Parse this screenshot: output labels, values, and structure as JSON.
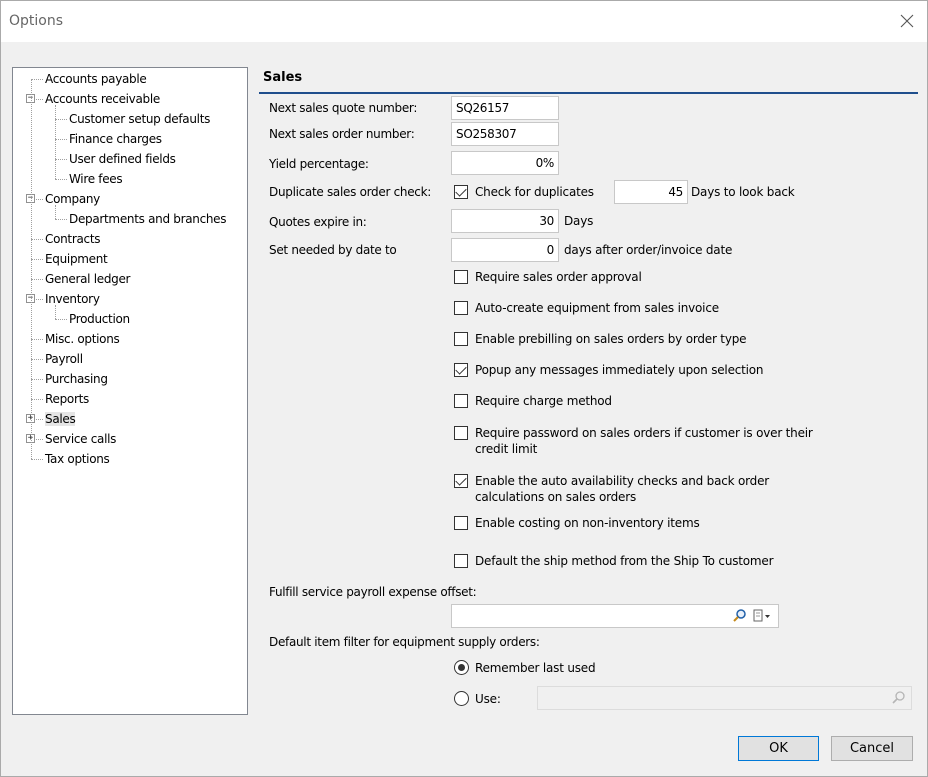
{
  "window": {
    "title": "Options"
  },
  "tree": [
    {
      "label": "Accounts payable",
      "level": 0,
      "expander": ""
    },
    {
      "label": "Accounts receivable",
      "level": 0,
      "expander": "−"
    },
    {
      "label": "Customer setup defaults",
      "level": 1,
      "expander": ""
    },
    {
      "label": "Finance charges",
      "level": 1,
      "expander": ""
    },
    {
      "label": "User defined fields",
      "level": 1,
      "expander": ""
    },
    {
      "label": "Wire fees",
      "level": 1,
      "expander": ""
    },
    {
      "label": "Company",
      "level": 0,
      "expander": "−"
    },
    {
      "label": "Departments and branches",
      "level": 1,
      "expander": ""
    },
    {
      "label": "Contracts",
      "level": 0,
      "expander": ""
    },
    {
      "label": "Equipment",
      "level": 0,
      "expander": ""
    },
    {
      "label": "General ledger",
      "level": 0,
      "expander": ""
    },
    {
      "label": "Inventory",
      "level": 0,
      "expander": "−"
    },
    {
      "label": "Production",
      "level": 1,
      "expander": ""
    },
    {
      "label": "Misc. options",
      "level": 0,
      "expander": ""
    },
    {
      "label": "Payroll",
      "level": 0,
      "expander": ""
    },
    {
      "label": "Purchasing",
      "level": 0,
      "expander": ""
    },
    {
      "label": "Reports",
      "level": 0,
      "expander": ""
    },
    {
      "label": "Sales",
      "level": 0,
      "expander": "+",
      "selected": true
    },
    {
      "label": "Service calls",
      "level": 0,
      "expander": "+"
    },
    {
      "label": "Tax options",
      "level": 0,
      "expander": ""
    }
  ],
  "section": {
    "title": "Sales"
  },
  "fields": {
    "next_quote_label": "Next sales quote number:",
    "next_quote_value": "SQ26157",
    "next_order_label": "Next sales order number:",
    "next_order_value": "SO258307",
    "yield_label": "Yield percentage:",
    "yield_value": "0%",
    "dup_label": "Duplicate sales order check:",
    "dup_check_label": "Check for duplicates",
    "dup_check": true,
    "dup_days_value": "45",
    "dup_days_label": "Days to look back",
    "quotes_label": "Quotes expire in:",
    "quotes_value": "30",
    "quotes_unit": "Days",
    "needed_label": "Set needed by date to",
    "needed_value": "0",
    "needed_unit": "days after order/invoice date"
  },
  "options": [
    {
      "label": "Require sales order approval",
      "checked": false
    },
    {
      "label": "Auto-create equipment from sales invoice",
      "checked": false
    },
    {
      "label": "Enable prebilling on sales orders by order type",
      "checked": false
    },
    {
      "label": "Popup any messages immediately upon selection",
      "checked": true
    },
    {
      "label": "Require charge method",
      "checked": false
    },
    {
      "label": "Require password on sales orders if customer is over their credit limit",
      "checked": false
    },
    {
      "label": "Enable the auto availability checks and back order calculations on sales orders",
      "checked": true
    },
    {
      "label": "Enable costing on non-inventory items",
      "checked": false
    },
    {
      "label": "Default the ship method from the Ship To customer",
      "checked": false
    }
  ],
  "fulfill": {
    "label": "Fulfill service payroll expense offset:",
    "value": ""
  },
  "filter": {
    "label": "Default item filter for equipment supply orders:",
    "remember_label": "Remember last used",
    "use_label": "Use:",
    "selected": "remember",
    "use_value": ""
  },
  "buttons": {
    "ok": "OK",
    "cancel": "Cancel"
  }
}
